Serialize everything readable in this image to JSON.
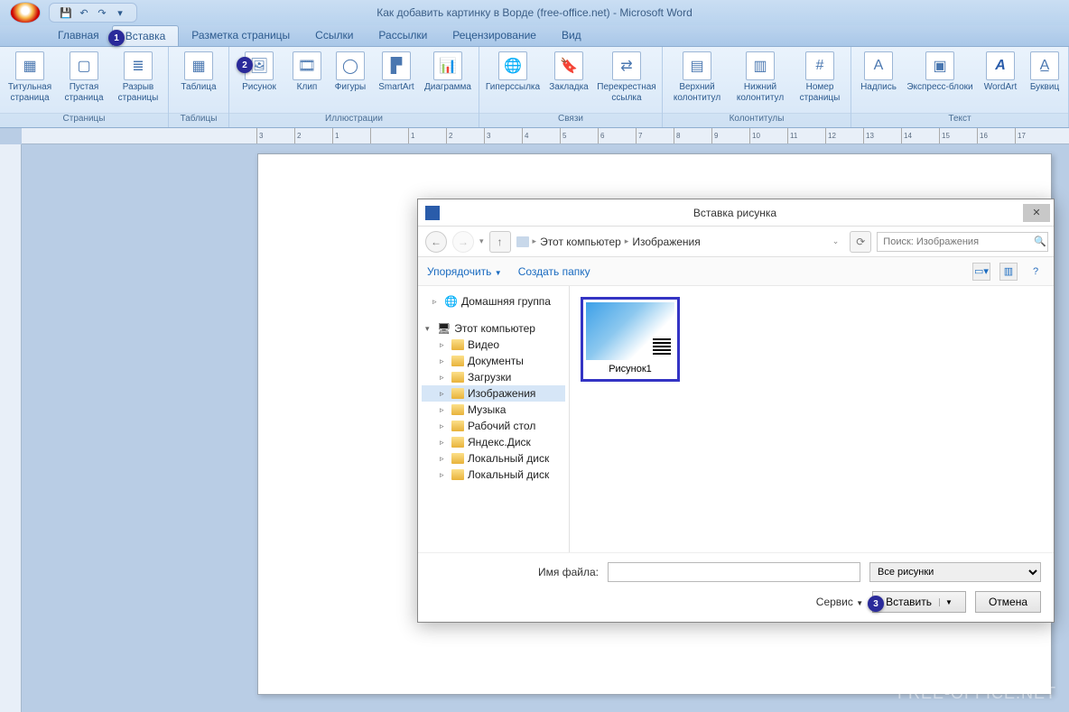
{
  "window": {
    "title": "Как добавить картинку в Ворде (free-office.net) - Microsoft Word"
  },
  "tabs": {
    "home": "Главная",
    "insert": "Вставка",
    "layout": "Разметка страницы",
    "links": "Ссылки",
    "mailings": "Рассылки",
    "review": "Рецензирование",
    "view": "Вид"
  },
  "ribbon": {
    "pages": {
      "label": "Страницы",
      "cover": "Титульная страница",
      "blank": "Пустая страница",
      "break": "Разрыв страницы"
    },
    "tables": {
      "label": "Таблицы",
      "table": "Таблица"
    },
    "illus": {
      "label": "Иллюстрации",
      "picture": "Рисунок",
      "clip": "Клип",
      "shapes": "Фигуры",
      "smartart": "SmartArt",
      "chart": "Диаграмма"
    },
    "links": {
      "label": "Связи",
      "hyperlink": "Гиперссылка",
      "bookmark": "Закладка",
      "cross": "Перекрестная ссылка"
    },
    "hf": {
      "label": "Колонтитулы",
      "header": "Верхний колонтитул",
      "footer": "Нижний колонтитул",
      "pagenum": "Номер страницы"
    },
    "text": {
      "label": "Текст",
      "textbox": "Надпись",
      "quick": "Экспресс-блоки",
      "wordart": "WordArt",
      "dropcap": "Буквиц"
    }
  },
  "ruler": {
    "ticks": [
      "3",
      "2",
      "1",
      "",
      "1",
      "2",
      "3",
      "4",
      "5",
      "6",
      "7",
      "8",
      "9",
      "10",
      "11",
      "12",
      "13",
      "14",
      "15",
      "16",
      "17"
    ]
  },
  "dialog": {
    "title": "Вставка рисунка",
    "breadcrumb": {
      "root": "Этот компьютер",
      "current": "Изображения"
    },
    "search_placeholder": "Поиск: Изображения",
    "toolbar": {
      "organize": "Упорядочить",
      "newfolder": "Создать папку"
    },
    "tree": {
      "homegroup": "Домашняя группа",
      "computer": "Этот компьютер",
      "children": [
        "Видео",
        "Документы",
        "Загрузки",
        "Изображения",
        "Музыка",
        "Рабочий стол",
        "Яндекс.Диск",
        "Локальный диск",
        "Локальный диск"
      ]
    },
    "thumb": {
      "name": "Рисунок1"
    },
    "footer": {
      "filename_label": "Имя файла:",
      "filter": "Все рисунки",
      "tools": "Сервис",
      "insert": "Вставить",
      "cancel": "Отмена"
    }
  },
  "badges": {
    "one": "1",
    "two": "2",
    "three": "3"
  },
  "watermark": "FREE-OFFICE.NET"
}
